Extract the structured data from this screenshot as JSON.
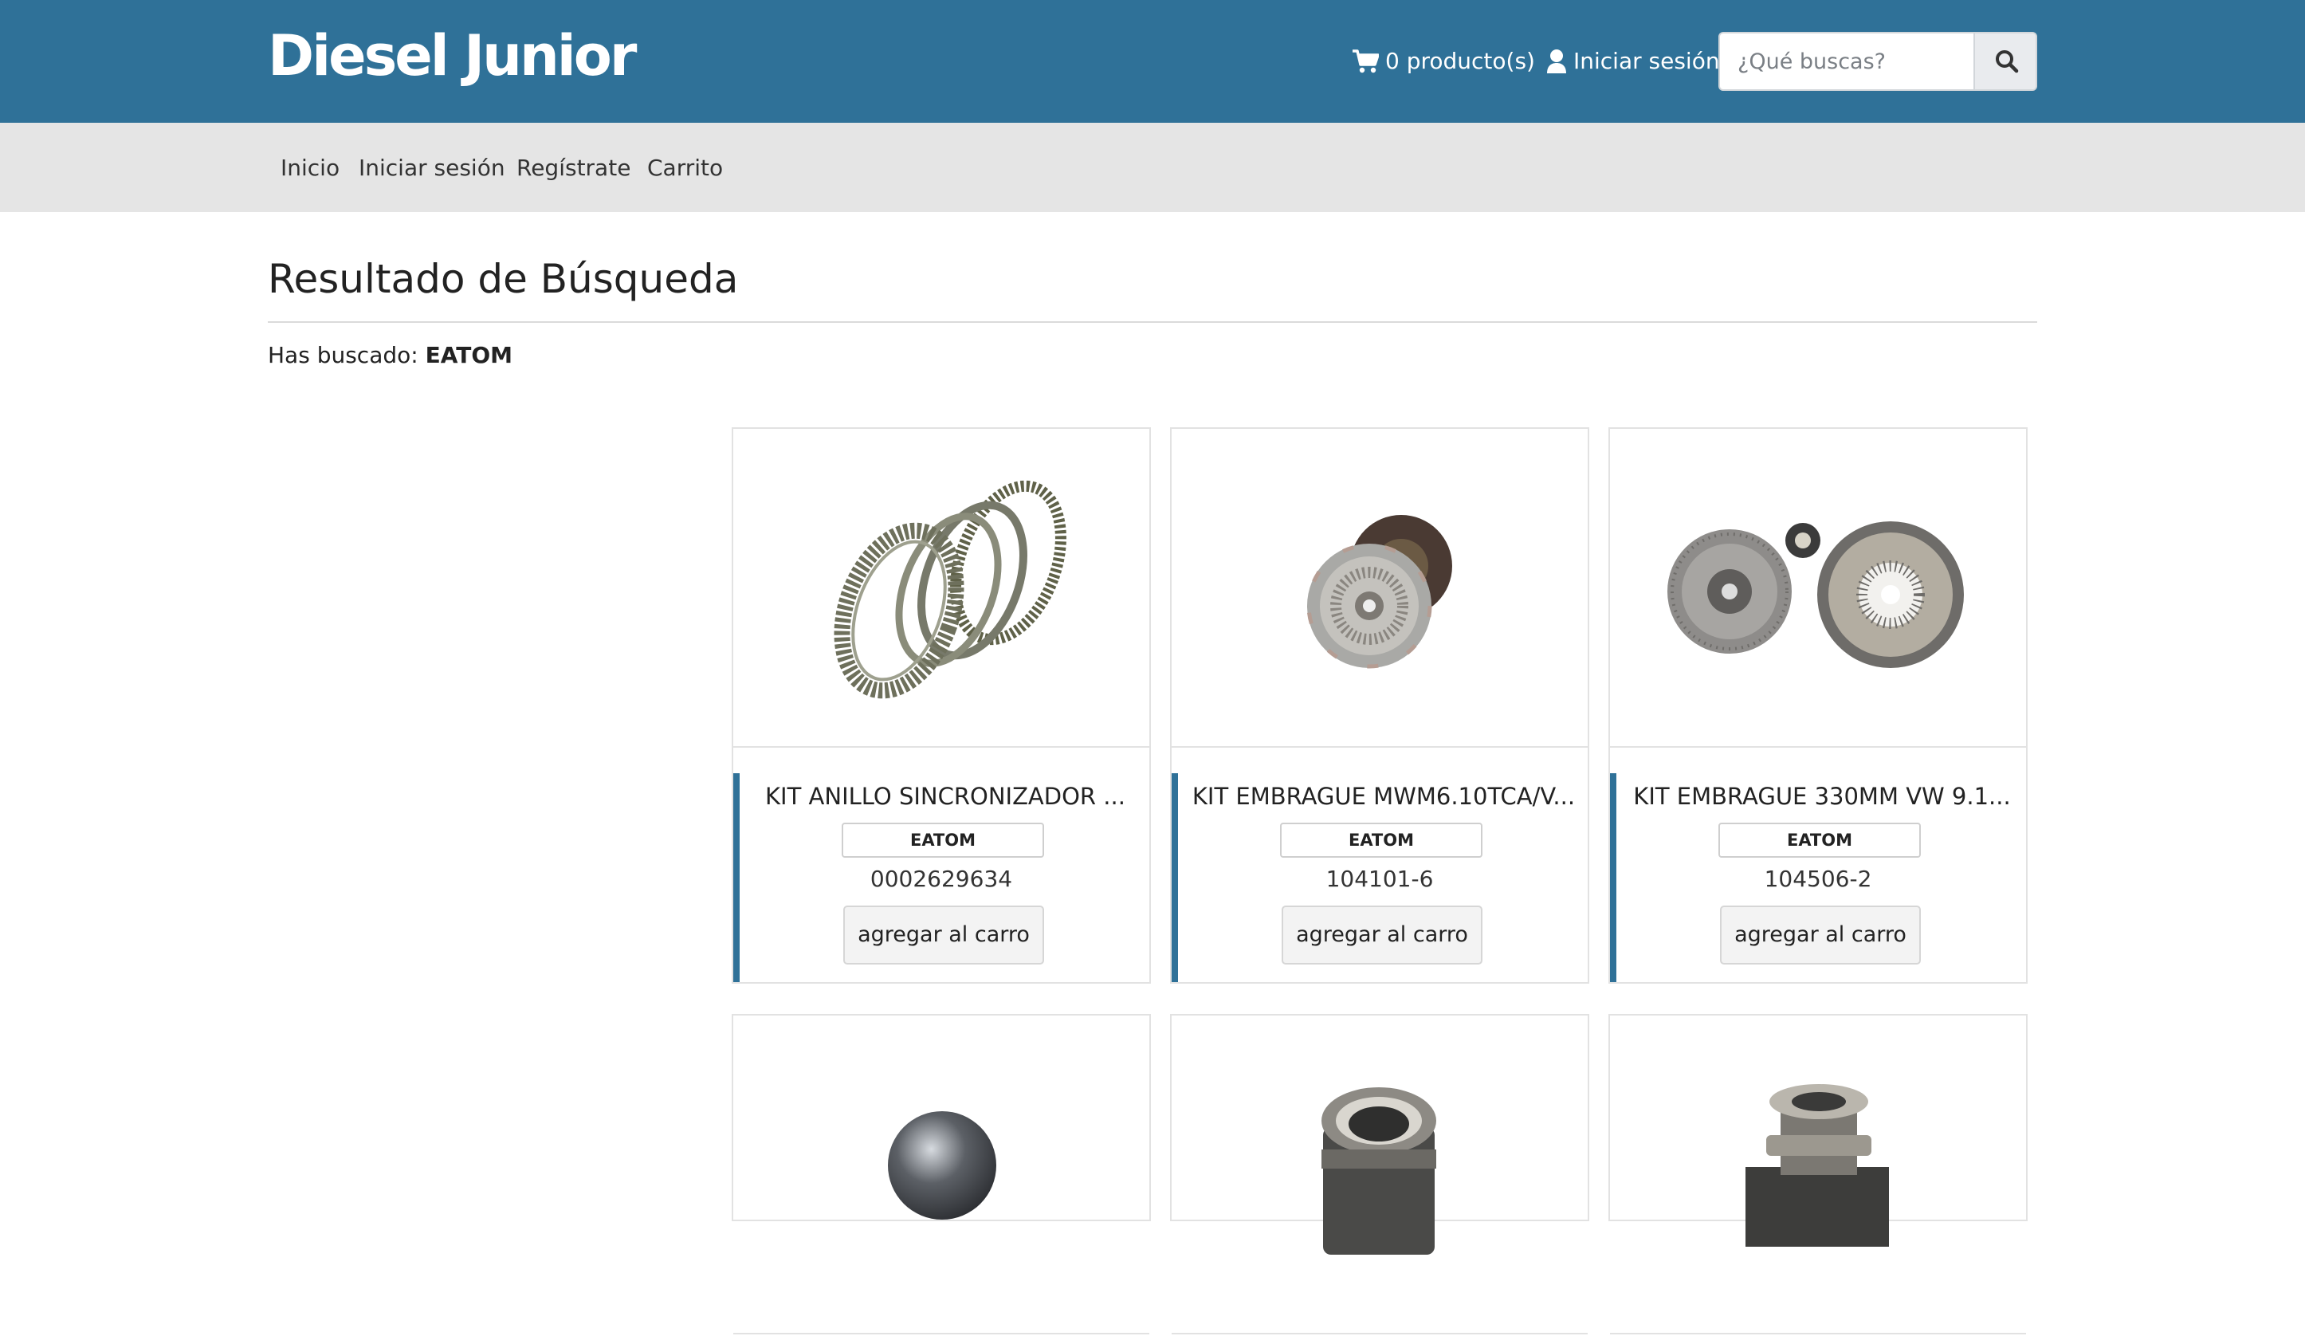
{
  "header": {
    "logo": "Diesel Junior",
    "cart_label": "0 producto(s)",
    "login_label": "Iniciar sesión",
    "search_placeholder": "¿Qué buscas?",
    "color": "#2f7198"
  },
  "nav": {
    "items": [
      {
        "label": "Inicio"
      },
      {
        "label": "Iniciar sesión"
      },
      {
        "label": "Regístrate"
      },
      {
        "label": "Carrito"
      }
    ]
  },
  "main": {
    "title": "Resultado de Búsqueda",
    "searched_prefix": "Has buscado:",
    "searched_term": "EATOM"
  },
  "products": [
    {
      "title": "KIT ANILLO SINCRONIZADOR ...",
      "brand": "EATOM",
      "code": "0002629634",
      "button": "agregar al carro",
      "image": "synchronizer-rings"
    },
    {
      "title": "KIT EMBRAGUE MWM6.10TCA/V...",
      "brand": "EATOM",
      "code": "104101-6",
      "button": "agregar al carro",
      "image": "clutch-kit"
    },
    {
      "title": "KIT EMBRAGUE 330MM VW 9.1...",
      "brand": "EATOM",
      "code": "104506-2",
      "button": "agregar al carro",
      "image": "clutch-kit-330"
    },
    {
      "image": "steel-ball"
    },
    {
      "image": "release-bearing"
    },
    {
      "image": "release-bearing-flange"
    }
  ]
}
